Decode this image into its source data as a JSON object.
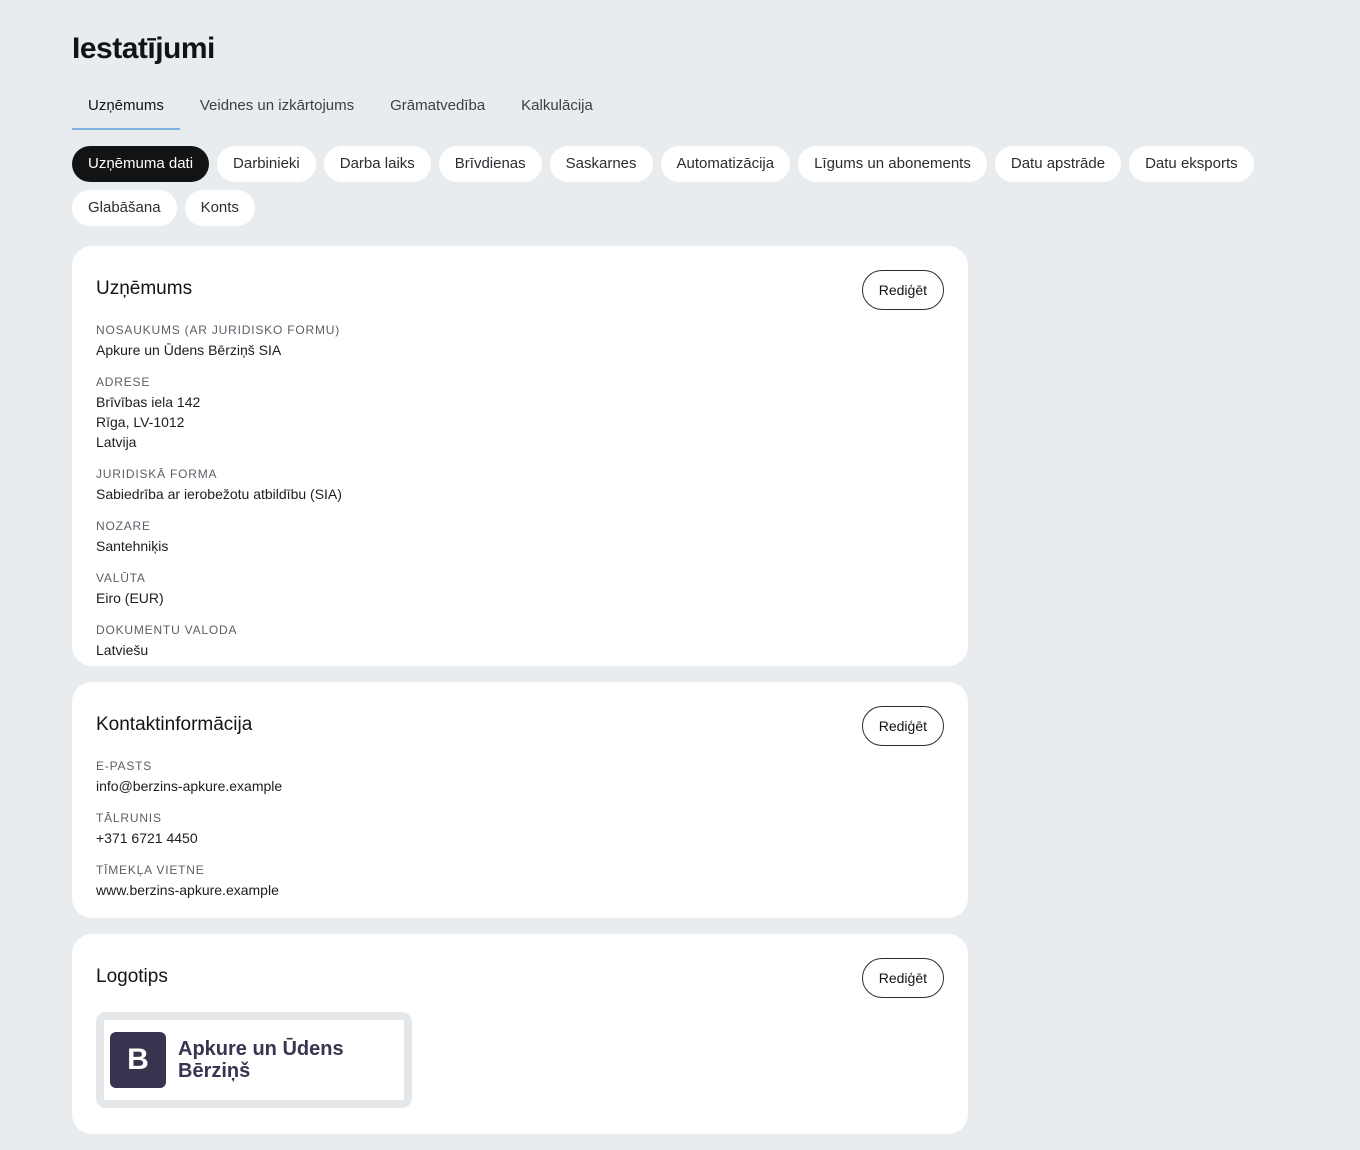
{
  "page": {
    "title": "Iestatījumi"
  },
  "tabs": [
    {
      "label": "Uzņēmums",
      "active": true
    },
    {
      "label": "Veidnes un izkārtojums"
    },
    {
      "label": "Grāmatvedība"
    },
    {
      "label": "Kalkulācija"
    }
  ],
  "pills": [
    {
      "label": "Uzņēmuma dati",
      "active": true
    },
    {
      "label": "Darbinieki"
    },
    {
      "label": "Darba laiks"
    },
    {
      "label": "Brīvdienas"
    },
    {
      "label": "Saskarnes"
    },
    {
      "label": "Automatizācija"
    },
    {
      "label": "Līgums un abonements"
    },
    {
      "label": "Datu apstrāde"
    },
    {
      "label": "Datu eksports"
    },
    {
      "label": "Glabāšana"
    },
    {
      "label": "Konts"
    }
  ],
  "company": {
    "title": "Uzņēmums",
    "edit_label": "Rediģēt",
    "fields": {
      "name_label": "NOSAUKUMS (AR JURIDISKO FORMU)",
      "name_value": "Apkure un Ūdens Bērziņš SIA",
      "address_label": "ADRESE",
      "address_line1": "Brīvības iela 142",
      "address_line2": "Rīga, LV-1012",
      "address_line3": "Latvija",
      "legal_label": "JURIDISKĀ FORMA",
      "legal_value": "Sabiedrība ar ierobežotu atbildību (SIA)",
      "industry_label": "NOZARE",
      "industry_value": "Santehniķis",
      "currency_label": "VALŪTA",
      "currency_value": "Eiro (EUR)",
      "doclang_label": "DOKUMENTU VALODA",
      "doclang_value": "Latviešu"
    }
  },
  "contact": {
    "title": "Kontaktinformācija",
    "edit_label": "Rediģēt",
    "fields": {
      "email_label": "E-PASTS",
      "email_value": "info@berzins-apkure.example",
      "phone_label": "TĀLRUNIS",
      "phone_value": "+371 6721 4450",
      "web_label": "TĪMEKĻA VIETNE",
      "web_value": "www.berzins-apkure.example"
    }
  },
  "logo": {
    "title": "Logotips",
    "edit_label": "Rediģēt",
    "mark": "B",
    "text": "Apkure un Ūdens Bērziņš",
    "mark_color": "#3a3350"
  },
  "colors": {
    "background": "#e9ecef",
    "tab_indicator": "#7fb0e0",
    "active_pill": "#111315"
  }
}
